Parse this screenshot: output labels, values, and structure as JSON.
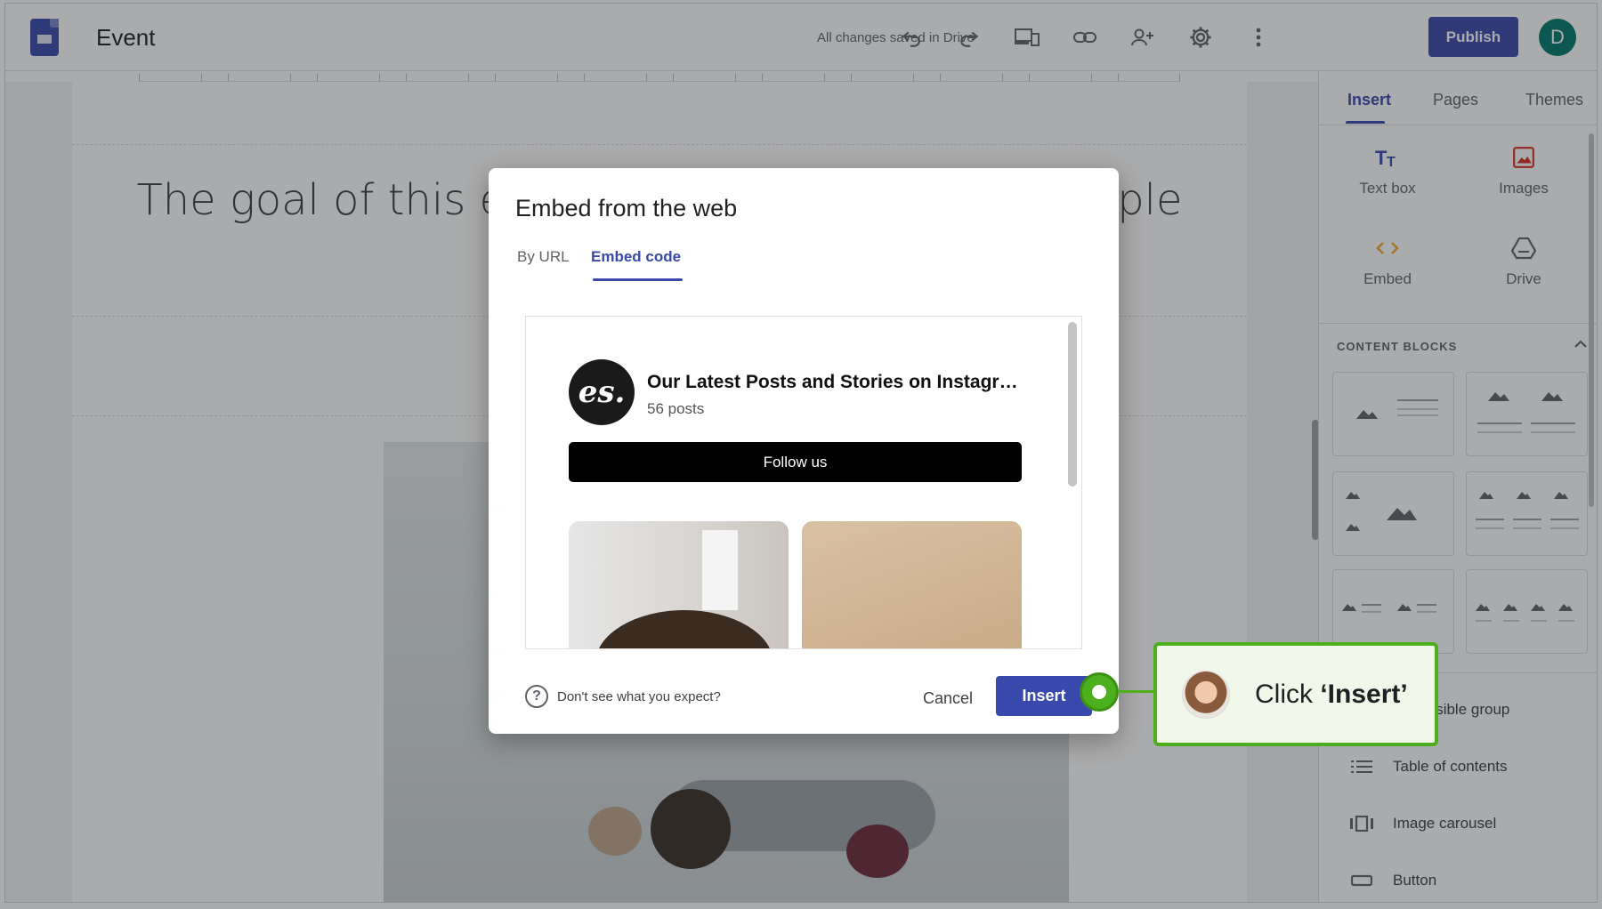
{
  "app": {
    "doc_title": "Event",
    "save_status": "All changes saved in Drive",
    "publish_label": "Publish",
    "avatar_letter": "D"
  },
  "toolbar": {
    "icons": [
      "undo-icon",
      "redo-icon",
      "preview-devices-icon",
      "link-icon",
      "share-person-add-icon",
      "settings-gear-icon",
      "more-vert-icon"
    ]
  },
  "canvas": {
    "hero_text": "The goal of this event is to bring together people in technology to"
  },
  "side_panel": {
    "tabs": [
      {
        "label": "Insert"
      },
      {
        "label": "Pages"
      },
      {
        "label": "Themes"
      }
    ],
    "insert_items": [
      {
        "label": "Text box",
        "icon": "text-box-icon"
      },
      {
        "label": "Images",
        "icon": "image-icon"
      },
      {
        "label": "Embed",
        "icon": "embed-code-icon"
      },
      {
        "label": "Drive",
        "icon": "drive-icon"
      }
    ],
    "content_blocks_title": "CONTENT BLOCKS",
    "list_items": [
      {
        "label": "Collapsible group",
        "icon": "collapsible-icon"
      },
      {
        "label": "Table of contents",
        "icon": "toc-icon"
      },
      {
        "label": "Image carousel",
        "icon": "carousel-icon"
      },
      {
        "label": "Button",
        "icon": "button-icon"
      }
    ]
  },
  "dialog": {
    "title": "Embed from the web",
    "tabs": [
      {
        "label": "By URL"
      },
      {
        "label": "Embed code"
      }
    ],
    "embed_preview": {
      "logo_text": "es.",
      "title": "Our Latest Posts and Stories on Instagr…",
      "subtitle": "56 posts",
      "follow_label": "Follow us"
    },
    "help_text": "Don't see what you expect?",
    "cancel_label": "Cancel",
    "insert_label": "Insert"
  },
  "guide": {
    "callout_prefix": "Click ",
    "callout_bold": "‘Insert’",
    "accent_color": "#4caf1e"
  },
  "colors": {
    "brand": "#3949ab",
    "overlay": "rgba(32,33,36,0.38)"
  }
}
